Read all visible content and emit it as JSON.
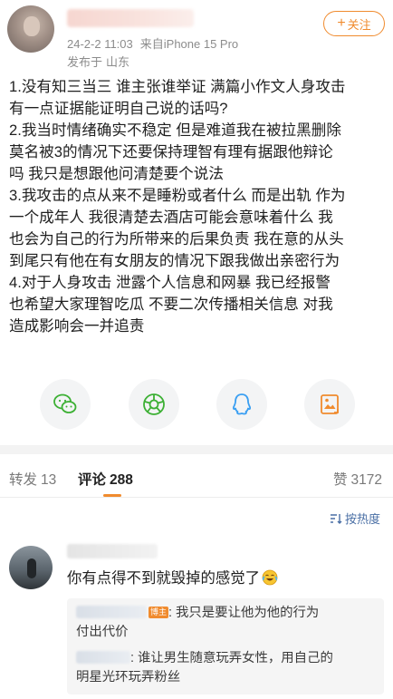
{
  "post": {
    "date": "24-2-2 11:03",
    "device": "来自iPhone 15 Pro",
    "location_prefix": "发布于",
    "location": "山东",
    "follow_label": "关注",
    "follow_plus": "+",
    "body_lines": [
      "1.没有知三当三 谁主张谁举证 满篇小作文人身攻击",
      "有一点证据能证明自己说的话吗?",
      "2.我当时情绪确实不稳定 但是难道我在被拉黑删除",
      "莫名被3的情况下还要保持理智有理有据跟他辩论",
      "吗 我只是想跟他问清楚要个说法",
      "3.我攻击的点从来不是睡粉或者什么 而是出轨 作为",
      "一个成年人 我很清楚去酒店可能会意味着什么 我",
      "也会为自己的行为所带来的后果负责 我在意的从头",
      "到尾只有他在有女朋友的情况下跟我做出亲密行为",
      "4.对于人身攻击 泄露个人信息和网暴 我已经报警",
      "也希望大家理智吃瓜 不要二次传播相关信息 对我",
      "造成影响会一并追责"
    ]
  },
  "share": [
    {
      "icon": "wechat-icon",
      "color": "#3cb034"
    },
    {
      "icon": "moments-icon",
      "color": "#3cb034"
    },
    {
      "icon": "qq-icon",
      "color": "#3a9ff2"
    },
    {
      "icon": "image-card-icon",
      "color": "#f08b2e"
    }
  ],
  "tabs": {
    "repost_label": "转发",
    "repost_count": "13",
    "comment_label": "评论",
    "comment_count": "288",
    "like_label": "赞",
    "like_count": "3172"
  },
  "sort_label": "按热度",
  "comment": {
    "text": "你有点得不到就毁掉的感觉了",
    "emoji": "laugh-cry-emoji",
    "replies": [
      {
        "name_fragment": "123",
        "badge": "博主",
        "text_line1": ": 我只是要让他为他的行为",
        "text_line2": "付出代价"
      },
      {
        "name_fragment": "人娱",
        "text": ": 谁让男生随意玩弄女性，用自己的",
        "text_line2": "明星光环玩弄粉丝"
      }
    ]
  },
  "colors": {
    "accent": "#f08b2e",
    "link": "#4a6fa5",
    "meta": "#8c8c8c"
  }
}
